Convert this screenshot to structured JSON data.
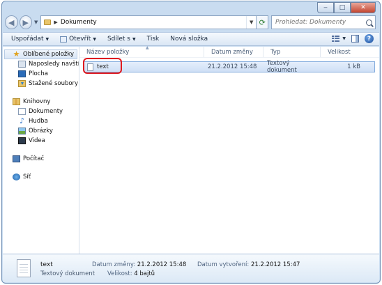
{
  "window": {
    "controls": {
      "minimize": "‒",
      "maximize": "□",
      "close": "✕"
    }
  },
  "address": {
    "path": "Dokumenty",
    "search_placeholder": "Prohledat: Dokumenty"
  },
  "toolbar": {
    "organize": "Uspořádat",
    "open": "Otevřít",
    "share": "Sdílet s",
    "print": "Tisk",
    "new_folder": "Nová složka"
  },
  "sidebar": {
    "favorites": {
      "label": "Oblíbené položky",
      "items": [
        {
          "label": "Naposledy navštíver",
          "icon": "recent-places-icon"
        },
        {
          "label": "Plocha",
          "icon": "desktop-icon"
        },
        {
          "label": "Stažené soubory",
          "icon": "downloads-icon"
        }
      ]
    },
    "libraries": {
      "label": "Knihovny",
      "items": [
        {
          "label": "Dokumenty",
          "icon": "documents-icon"
        },
        {
          "label": "Hudba",
          "icon": "music-icon"
        },
        {
          "label": "Obrázky",
          "icon": "pictures-icon"
        },
        {
          "label": "Videa",
          "icon": "videos-icon"
        }
      ]
    },
    "computer": {
      "label": "Počítač"
    },
    "network": {
      "label": "Síť"
    }
  },
  "filelist": {
    "columns": {
      "name": "Název položky",
      "date": "Datum změny",
      "type": "Typ",
      "size": "Velikost"
    },
    "files": [
      {
        "name": "text",
        "date": "21.2.2012 15:48",
        "type": "Textový dokument",
        "size": "1 kB"
      }
    ]
  },
  "details": {
    "name": "text",
    "type": "Textový dokument",
    "modified_label": "Datum změny:",
    "modified_value": "21.2.2012 15:48",
    "size_label": "Velikost:",
    "size_value": "4 bajtů",
    "created_label": "Datum vytvoření:",
    "created_value": "21.2.2012 15:47"
  },
  "colors": {
    "chrome": "#c9dcf0",
    "selection": "#cfe0f6",
    "annotation": "#e0191f"
  }
}
